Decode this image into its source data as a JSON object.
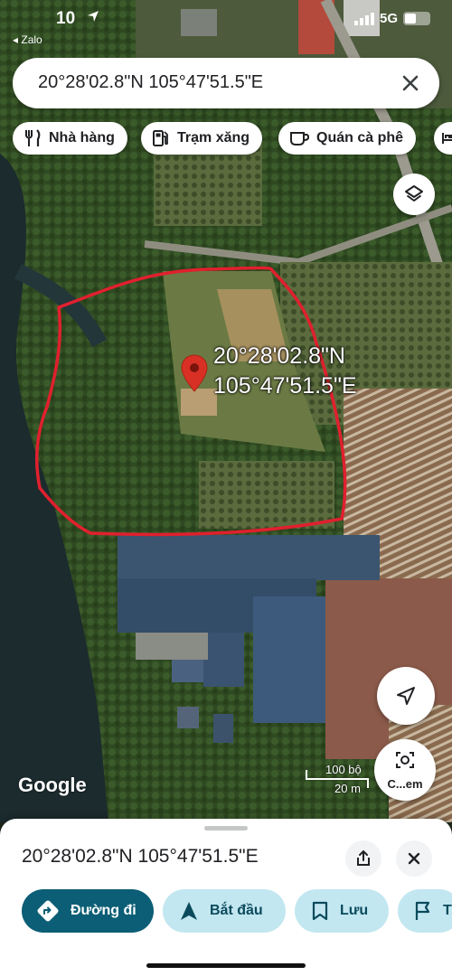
{
  "status_bar": {
    "time": "10",
    "back_app": "◂ Zalo",
    "network": "5G"
  },
  "search": {
    "query": "20°28'02.8\"N 105°47'51.5\"E"
  },
  "chips": [
    {
      "label": "Nhà hàng",
      "icon": "fork-knife-icon"
    },
    {
      "label": "Trạm xăng",
      "icon": "gas-station-icon"
    },
    {
      "label": "Quán cà phê",
      "icon": "coffee-cup-icon"
    }
  ],
  "map": {
    "pin_label_line1": "20°28'02.8\"N",
    "pin_label_line2": "105°47'51.5\"E",
    "attribution": "Google",
    "scale_imperial": "100 bộ",
    "scale_metric": "20 m",
    "camera_label": "C...em",
    "highlight_color": "#e0202e",
    "pin_color": "#d93025"
  },
  "sheet": {
    "title": "20°28'02.8\"N 105°47'51.5\"E",
    "actions": [
      {
        "label": "Đường đi",
        "icon": "directions-icon"
      },
      {
        "label": "Bắt đầu",
        "icon": "navigation-arrow-icon"
      },
      {
        "label": "Lưu",
        "icon": "bookmark-icon"
      },
      {
        "label": "T",
        "icon": "flag-icon"
      }
    ]
  },
  "colors": {
    "primary_button": "#0b5e75",
    "secondary_button": "#c2e7f0"
  }
}
